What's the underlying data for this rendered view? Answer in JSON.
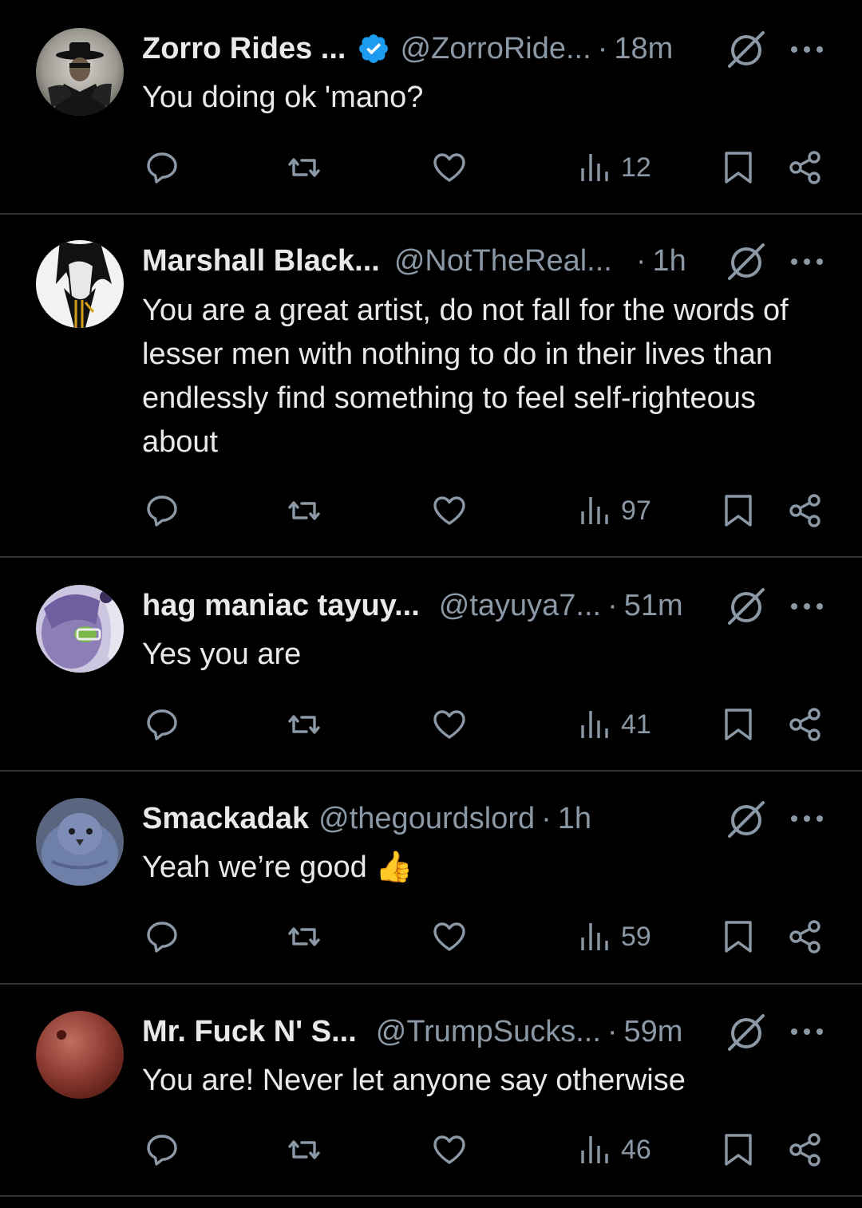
{
  "posts": [
    {
      "display_name": "Zorro Rides ...",
      "verified": true,
      "handle": "@ZorroRide...",
      "separator": "·",
      "time": "18m",
      "text": "You doing ok 'mano?",
      "views": "12",
      "avatar": "zorro-masked-rider-avatar"
    },
    {
      "display_name": "Marshall Black...",
      "verified": false,
      "handle": "@NotTheReal...",
      "separator": "·",
      "time": "1h",
      "text": "You are a great artist, do not fall for the words of lesser men with nothing to do in their lives than endlessly find something to feel self-righteous about",
      "views": "97",
      "avatar": "dark-haired-figure-avatar"
    },
    {
      "display_name": "hag maniac tayuy...",
      "verified": false,
      "handle": "@tayuya7...",
      "separator": "·",
      "time": "51m",
      "text": "Yes you are",
      "views": "41",
      "avatar": "purple-character-avatar"
    },
    {
      "display_name": "Smackadak",
      "verified": false,
      "handle": "@thegourdslord",
      "separator": "·",
      "time": "1h",
      "text": "Yeah we’re good 👍",
      "views": "59",
      "avatar": "blue-pigeon-avatar"
    },
    {
      "display_name": "Mr. Fuck N' S...",
      "verified": false,
      "handle": "@TrumpSucks...",
      "separator": "·",
      "time": "59m",
      "text": "You are! Never let anyone say otherwise",
      "views": "46",
      "avatar": "red-blurred-avatar"
    }
  ],
  "icons": {
    "reply": "reply-icon",
    "repost": "repost-icon",
    "like": "heart-icon",
    "views": "views-icon",
    "bookmark": "bookmark-icon",
    "share": "share-icon",
    "grok": "grok-icon",
    "more": "more-icon",
    "verified": "verified-badge-icon"
  },
  "colors": {
    "background": "#000000",
    "primary_text": "#e7e9ea",
    "secondary_text": "#8b98a5",
    "divider": "#2f3336",
    "verified_blue": "#1d9bf0"
  }
}
